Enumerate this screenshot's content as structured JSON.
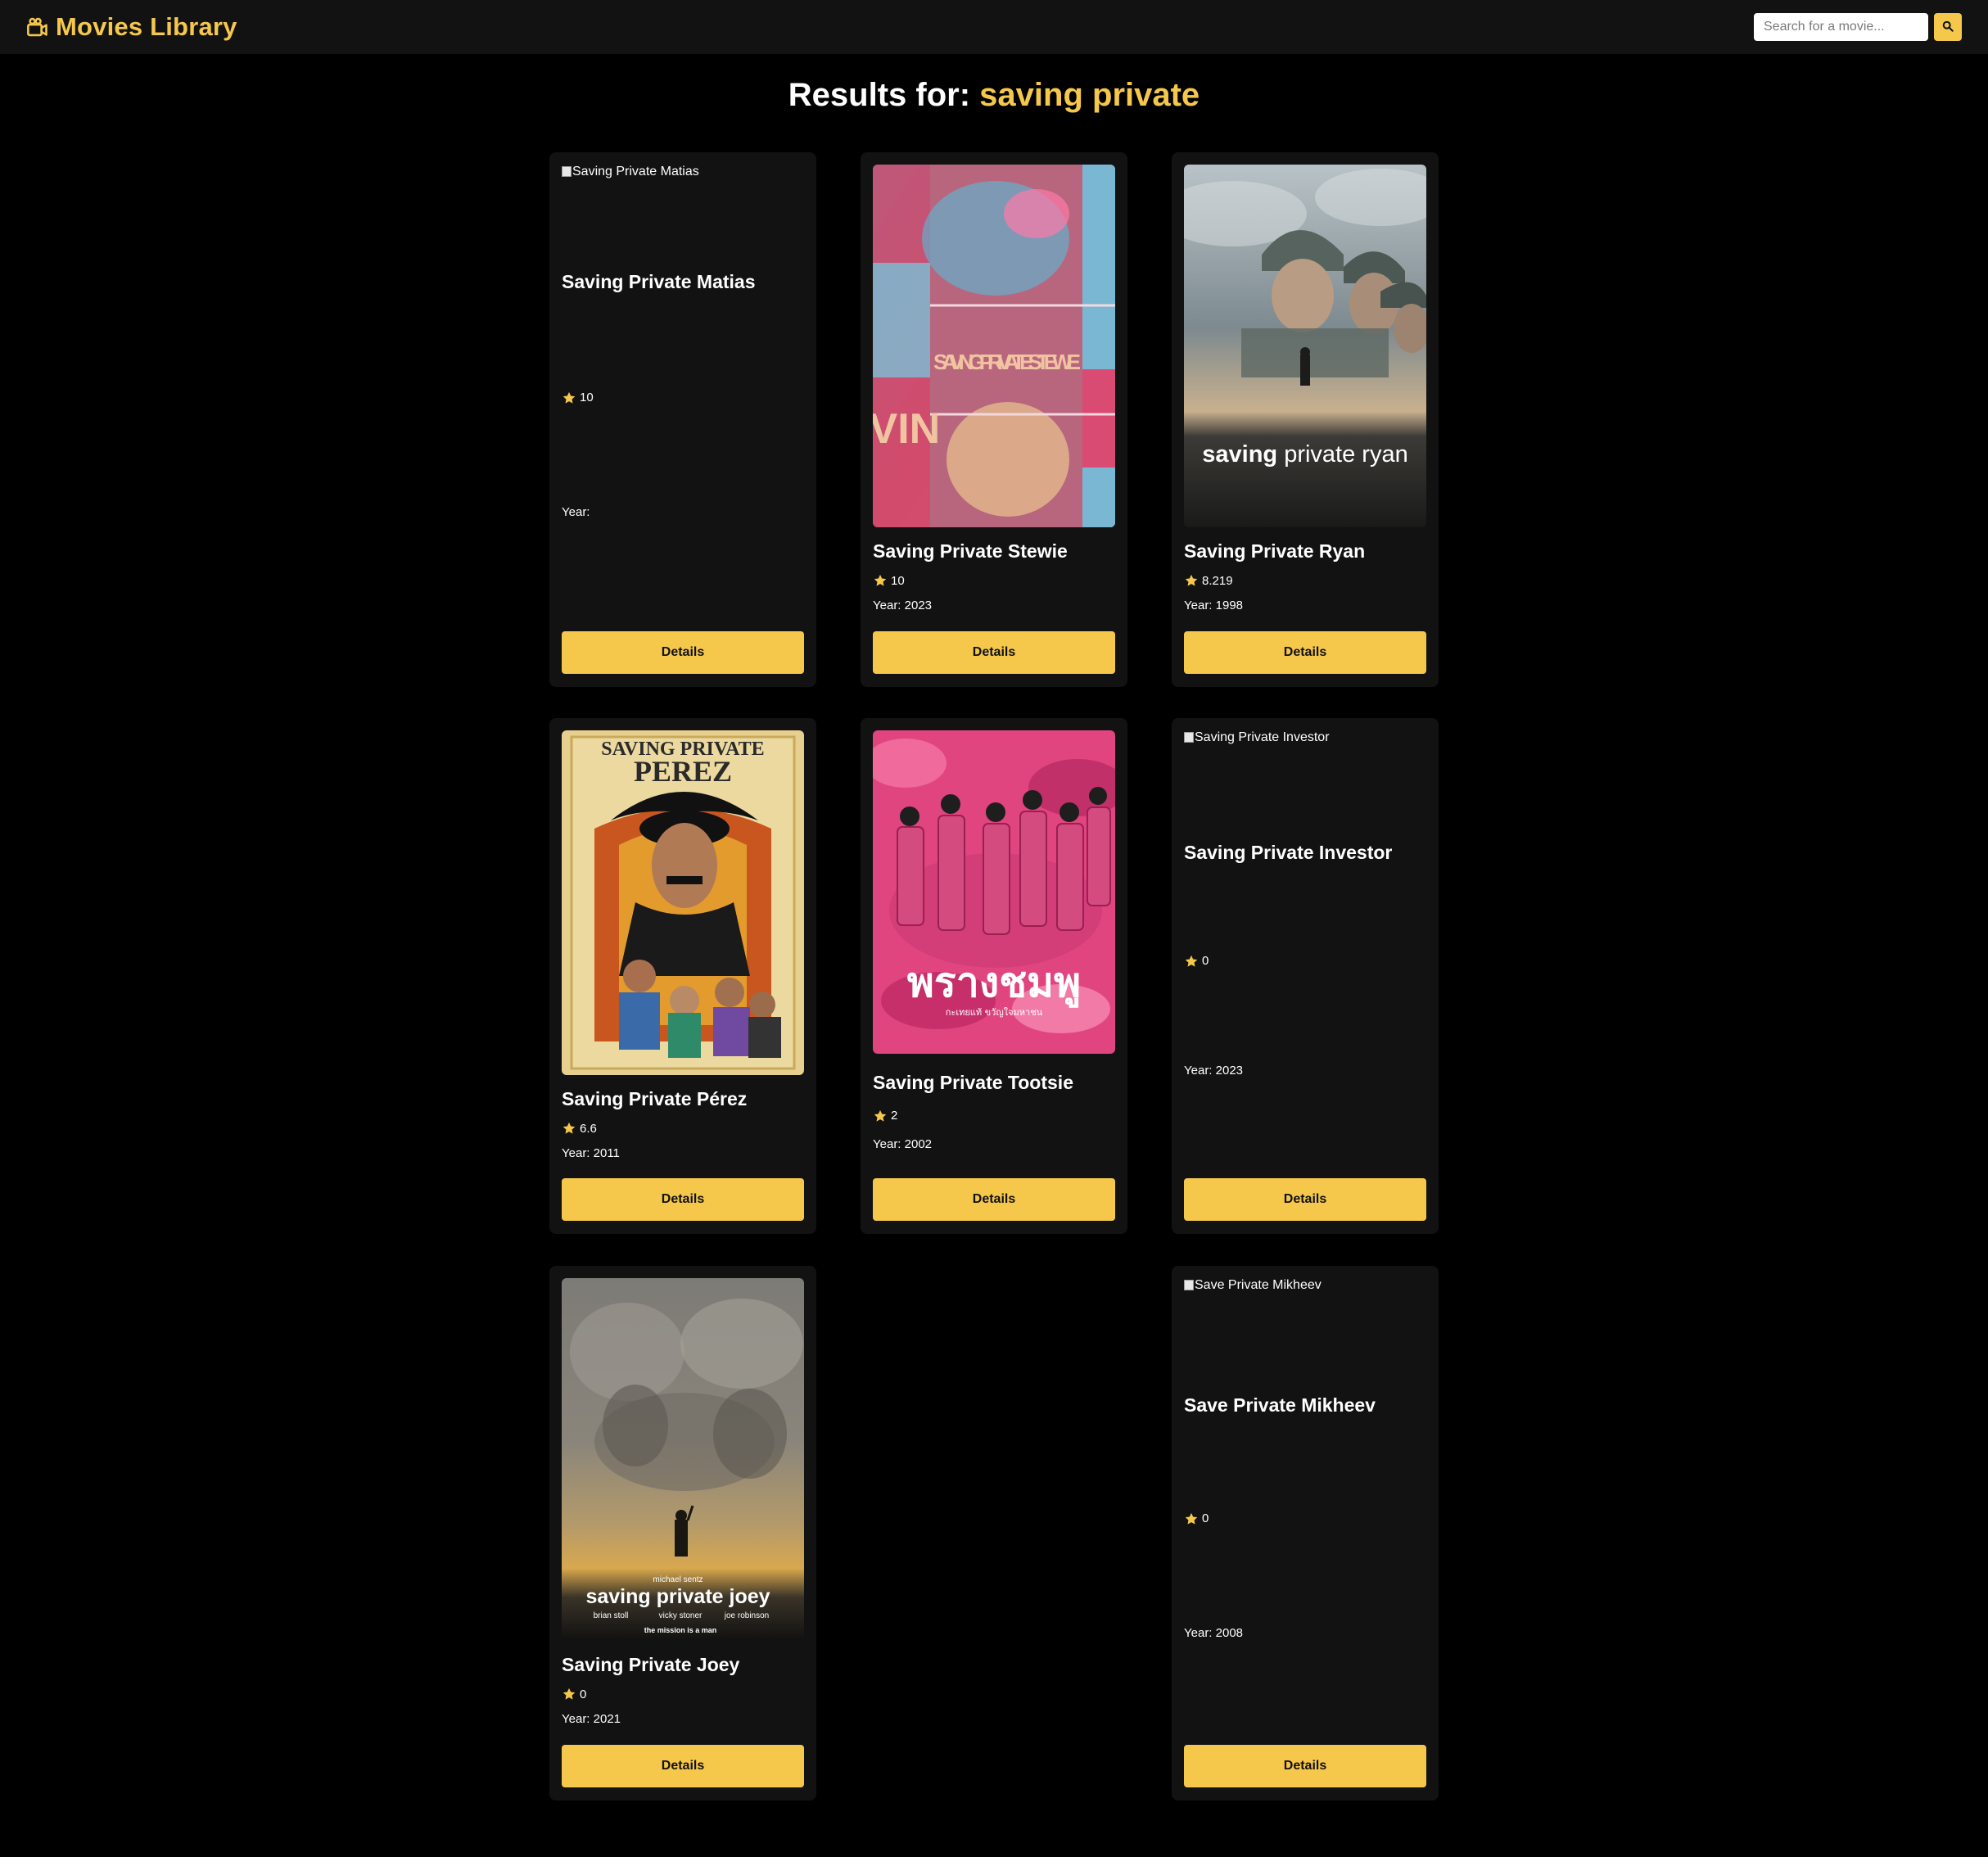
{
  "navbar": {
    "brand": "Movies Library",
    "brand_icon": "video-camera-icon",
    "search_placeholder": "Search for a movie...",
    "search_icon": "search-icon"
  },
  "heading": {
    "prefix": "Results for:",
    "query": "saving private"
  },
  "colors": {
    "accent": "#f5c84c",
    "background": "#000000",
    "card": "#121212",
    "navbar": "#121212"
  },
  "movies": [
    {
      "title": "Saving Private Matias",
      "poster_alt": "Saving Private Matias",
      "poster_loaded": false,
      "rating": "10",
      "year": "Year:",
      "button": "Details"
    },
    {
      "title": "Saving Private Stewie",
      "poster_alt": "Saving Private Stewie",
      "poster_loaded": true,
      "poster_text": "SAVING PRIVATE STEWIE",
      "rating": "10",
      "year": "Year: 2023",
      "button": "Details"
    },
    {
      "title": "Saving Private Ryan",
      "poster_alt": "Saving Private Ryan",
      "poster_loaded": true,
      "poster_text": "saving private ryan",
      "rating": "8.219",
      "year": "Year: 1998",
      "button": "Details"
    },
    {
      "title": "Saving Private Pérez",
      "poster_alt": "Saving Private Pérez",
      "poster_loaded": true,
      "poster_text": "SAVING PRIVATE PEREZ",
      "rating": "6.6",
      "year": "Year: 2011",
      "button": "Details"
    },
    {
      "title": "Saving Private Tootsie",
      "poster_alt": "Saving Private Tootsie",
      "poster_loaded": true,
      "poster_text": "พรางชมพู",
      "rating": "2",
      "year": "Year: 2002",
      "button": "Details"
    },
    {
      "title": "Saving Private Investor",
      "poster_alt": "Saving Private Investor",
      "poster_loaded": false,
      "rating": "0",
      "year": "Year: 2023",
      "button": "Details"
    },
    {
      "title": "Saving Private Joey",
      "poster_alt": "Saving Private Joey",
      "poster_loaded": true,
      "poster_text": "saving private joey",
      "poster_credit_top": "michael sentz",
      "poster_credits": [
        "brian stoll",
        "vicky stoner",
        "joe robinson"
      ],
      "poster_tagline": "the mission is a man",
      "rating": "0",
      "year": "Year: 2021",
      "button": "Details"
    },
    {
      "title": "Save Private Mikheev",
      "poster_alt": "Save Private Mikheev",
      "poster_loaded": false,
      "rating": "0",
      "year": "Year: 2008",
      "button": "Details"
    }
  ]
}
